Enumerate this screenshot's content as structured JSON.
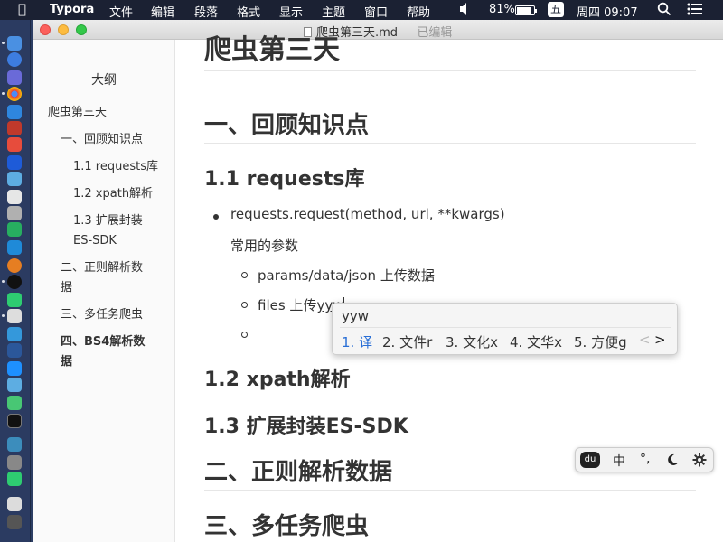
{
  "menubar": {
    "apple_icon": "apple-icon",
    "app_name": "Typora",
    "menus": [
      "文件",
      "编辑",
      "段落",
      "格式",
      "显示",
      "主题",
      "窗口",
      "帮助"
    ],
    "battery_percent": "81%",
    "battery_level": 0.81,
    "input_source": "五",
    "clock": "周四 09:07"
  },
  "window": {
    "title": "爬虫第三天.md",
    "status": "— 已编辑"
  },
  "outline": {
    "heading": "大纲",
    "items": [
      "爬虫第三天",
      "一、回顾知识点",
      "1.1 requests库",
      "1.2 xpath解析",
      "1.3 扩展封装",
      "ES-SDK",
      "二、正则解析数",
      "据",
      "三、多任务爬虫",
      "四、BS4解析数",
      "据"
    ]
  },
  "content": {
    "doc_title": "爬虫第三天",
    "h1_review": "一、回顾知识点",
    "h2_requests": "1.1 requests库",
    "bullet_request": "requests.request(method, url, **kwargs)",
    "common_params": "常用的参数",
    "params_item": "params/data/json   上传数据",
    "files_item_prefix": "files  上传",
    "files_item_typed": "yyw",
    "h2_xpath": "1.2 xpath解析",
    "h2_extend": "1.3 扩展封装ES-SDK",
    "h1_regex": "二、正则解析数据",
    "h1_multitask": "三、多任务爬虫"
  },
  "ime": {
    "input": "yyw",
    "candidates": [
      "1. 译",
      "2. 文件r",
      "3. 文化x",
      "4. 文华x",
      "5. 方便g"
    ],
    "prev": "<",
    "next": ">"
  },
  "ime_toolbar": {
    "logo": "du",
    "mode": "中",
    "punct": "°,",
    "theme_icon": "moon-icon",
    "settings_icon": "gear-icon"
  },
  "colors": {
    "candidate_selected": "#2a6fd6",
    "menubar_bg": "#1b2133"
  }
}
